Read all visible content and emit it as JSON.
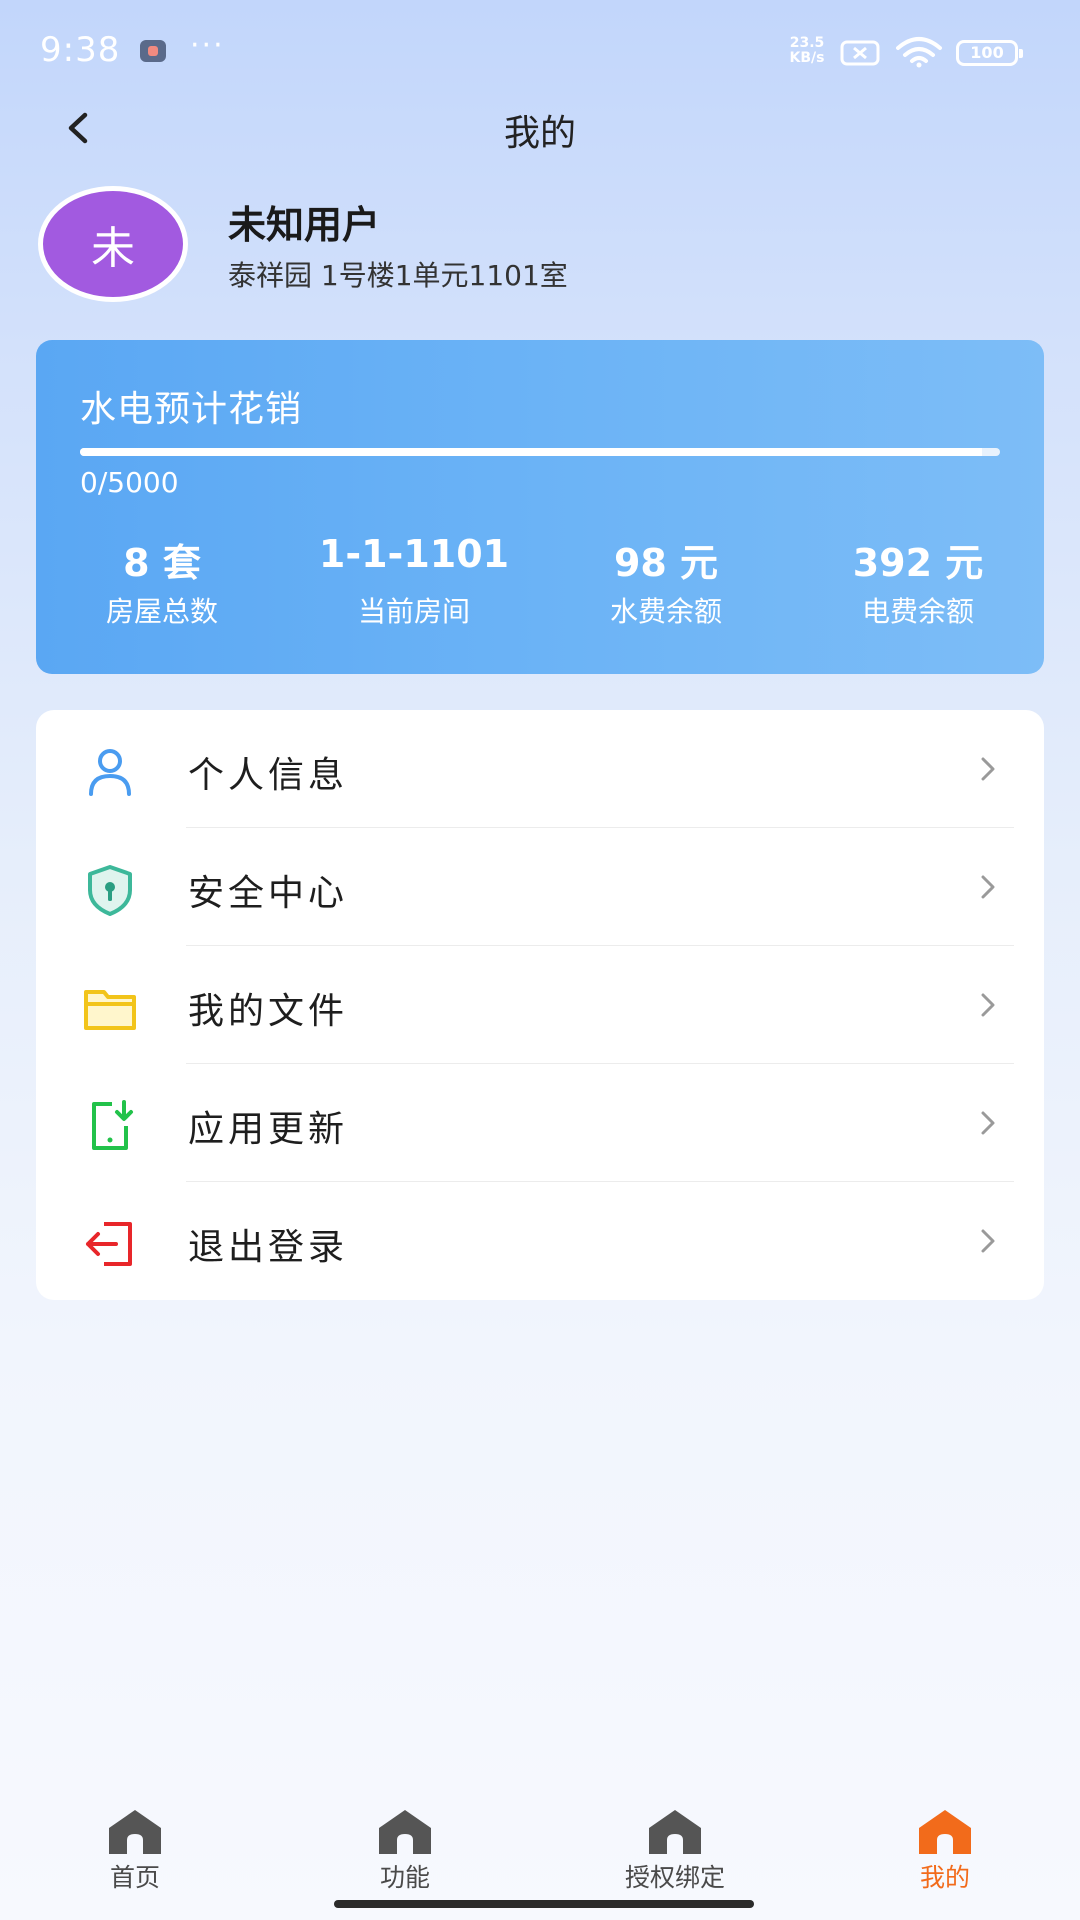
{
  "status_bar": {
    "time": "9:38",
    "dots": "···",
    "network_speed_value": "23.5",
    "network_speed_unit": "KB/s",
    "battery": "100"
  },
  "header": {
    "title": "我的"
  },
  "profile": {
    "avatar_char": "未",
    "name": "未知用户",
    "address": "泰祥园 1号楼1单元1101室"
  },
  "stats_card": {
    "title": "水电预计花销",
    "progress_text": "0/5000",
    "progress_fraction": 0.98,
    "stats": [
      {
        "value": "8 套",
        "label": "房屋总数"
      },
      {
        "value": "1-1-1101",
        "label": "当前房间"
      },
      {
        "value": "98 元",
        "label": "水费余额"
      },
      {
        "value": "392 元",
        "label": "电费余额"
      }
    ]
  },
  "menu": {
    "items": [
      {
        "label": "个人信息",
        "icon": "user-icon",
        "color": "#4a9cf0"
      },
      {
        "label": "安全中心",
        "icon": "shield-lock-icon",
        "color": "#3db89a"
      },
      {
        "label": "我的文件",
        "icon": "folder-icon",
        "color": "#f2c41a"
      },
      {
        "label": "应用更新",
        "icon": "app-update-icon",
        "color": "#22c24a"
      },
      {
        "label": "退出登录",
        "icon": "logout-icon",
        "color": "#e8262a"
      }
    ]
  },
  "bottom_nav": {
    "items": [
      {
        "label": "首页",
        "icon": "home-icon",
        "active": false
      },
      {
        "label": "功能",
        "icon": "home-icon",
        "active": false
      },
      {
        "label": "授权绑定",
        "icon": "home-icon",
        "active": false
      },
      {
        "label": "我的",
        "icon": "home-icon",
        "active": true
      }
    ],
    "inactive_color": "#555555",
    "active_color": "#f26b1b"
  }
}
